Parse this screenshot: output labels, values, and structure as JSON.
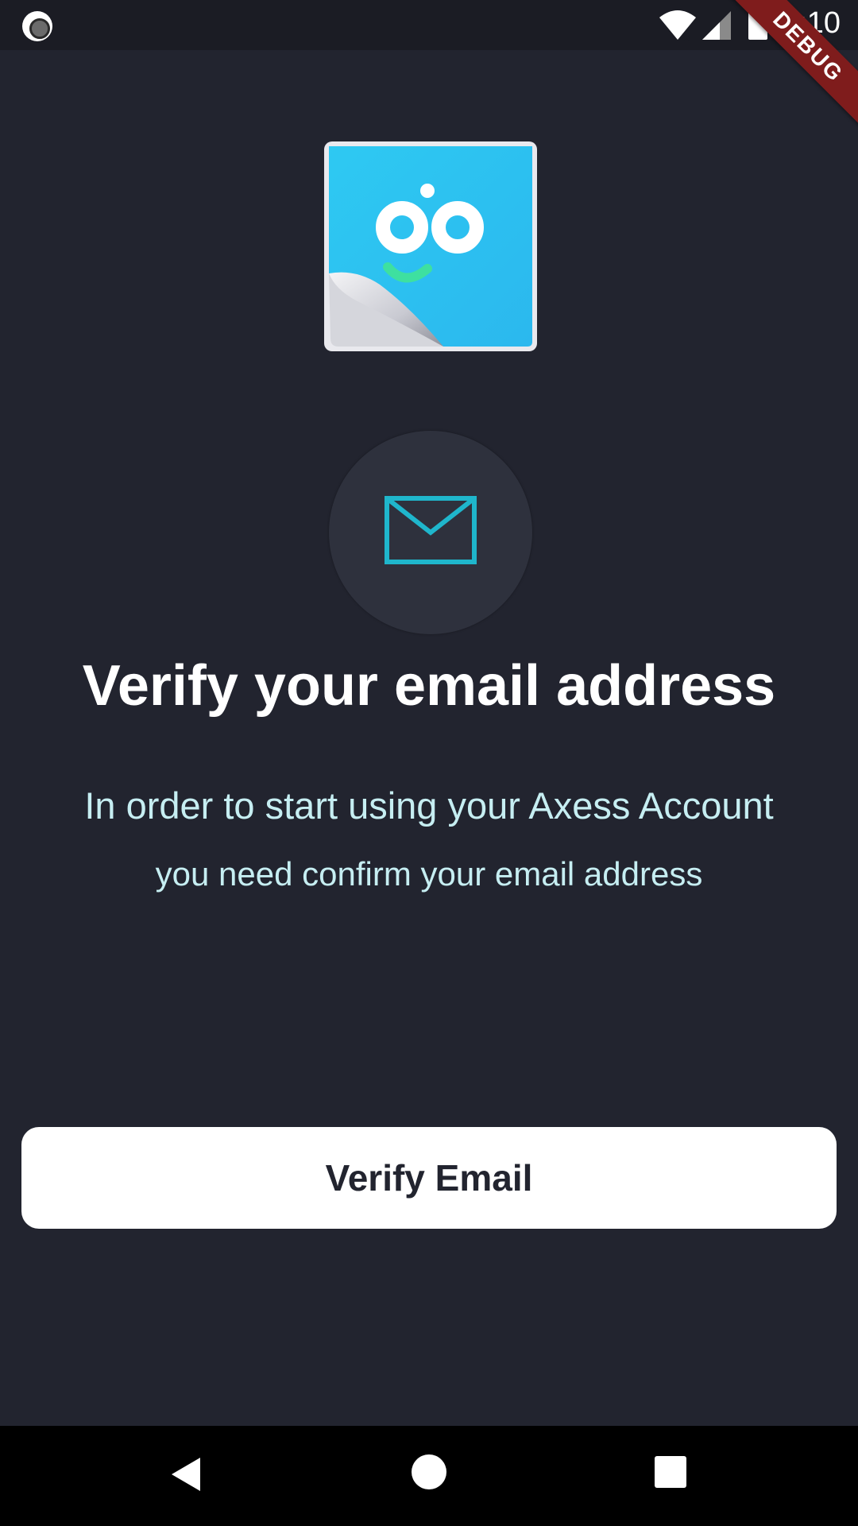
{
  "status_bar": {
    "time": "6:10",
    "icons": [
      "record-icon",
      "wifi-icon",
      "signal-icon",
      "battery-icon"
    ],
    "debug_label": "DEBUG"
  },
  "logo": {
    "icon": "app-logo-icon",
    "colors": {
      "primary": "#2fc8f0",
      "smile": "#3ee0a0"
    }
  },
  "mail_badge": {
    "icon": "mail-icon",
    "color": "#1fb6cc"
  },
  "content": {
    "title": "Verify your email address",
    "subtitle_line1": "In order to start using your Axess Account",
    "subtitle_line2": "you need confirm your email address"
  },
  "actions": {
    "verify_label": "Verify Email"
  },
  "nav_bar": {
    "icons": [
      "back-icon",
      "home-icon",
      "recents-icon"
    ]
  },
  "theme": {
    "background": "#22242f",
    "text_accent": "#c6eef2",
    "button_bg": "#ffffff",
    "debug_ribbon": "#7f1c1c"
  }
}
